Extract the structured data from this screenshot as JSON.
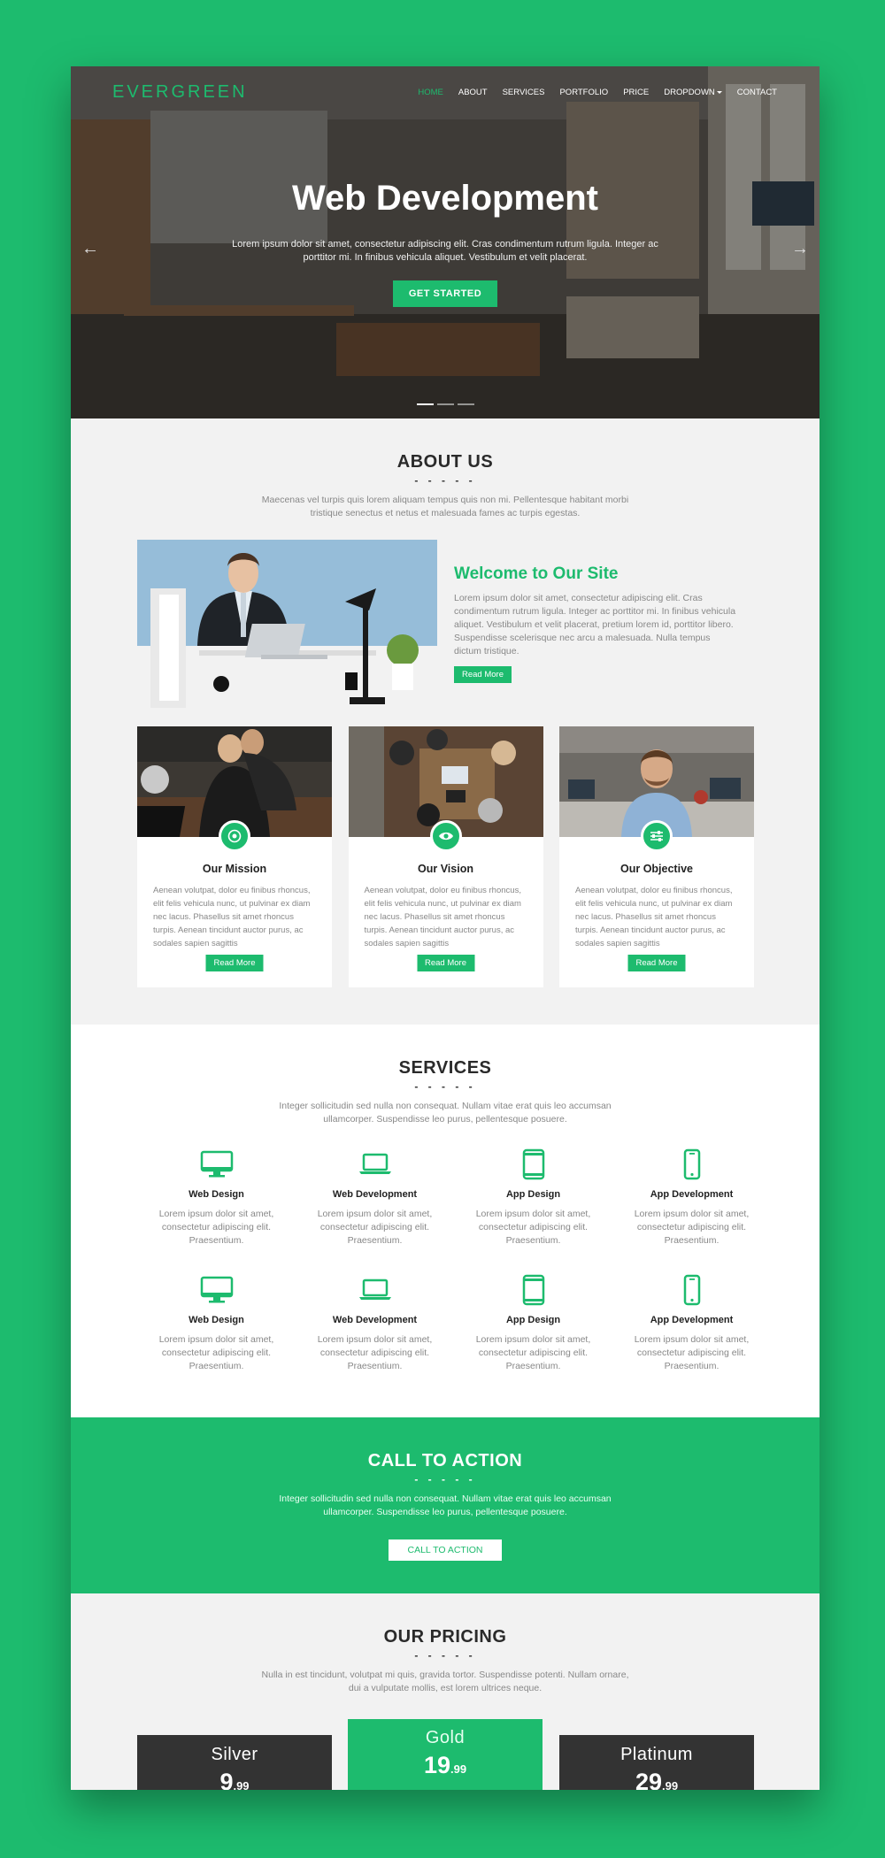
{
  "brand": {
    "logo": "EVERGREEN",
    "accent": "#1dbb6e"
  },
  "nav": {
    "items": [
      {
        "label": "HOME",
        "active": true
      },
      {
        "label": "ABOUT"
      },
      {
        "label": "SERVICES"
      },
      {
        "label": "PORTFOLIO"
      },
      {
        "label": "PRICE"
      },
      {
        "label": "DROPDOWN"
      },
      {
        "label": "CONTACT"
      }
    ]
  },
  "hero": {
    "title": "Web Development",
    "text": "Lorem ipsum dolor sit amet, consectetur adipiscing elit. Cras condimentum rutrum ligula. Integer ac porttitor mi. In finibus vehicula aliquet. Vestibulum et velit placerat.",
    "button": "GET STARTED"
  },
  "about": {
    "title": "ABOUT US",
    "dashes": "- - - - -",
    "subtitle": "Maecenas vel turpis quis lorem aliquam tempus quis non mi. Pellentesque habitant morbi tristique senectus et netus et malesuada fames ac turpis egestas.",
    "welcome": {
      "title": "Welcome to Our Site",
      "body": "Lorem ipsum dolor sit amet, consectetur adipiscing elit. Cras condimentum rutrum ligula. Integer ac porttitor mi. In finibus vehicula aliquet. Vestibulum et velit placerat, pretium lorem id, porttitor libero. Suspendisse scelerisque nec arcu a malesuada. Nulla tempus dictum tristique.",
      "button": "Read More"
    },
    "cards": [
      {
        "title": "Our Mission",
        "icon": "target-icon",
        "body": "Aenean volutpat, dolor eu finibus rhoncus, elit felis vehicula nunc, ut pulvinar ex diam nec lacus. Phasellus sit amet rhoncus turpis. Aenean tincidunt auctor purus, ac sodales sapien sagittis",
        "button": "Read More"
      },
      {
        "title": "Our Vision",
        "icon": "eye-icon",
        "body": "Aenean volutpat, dolor eu finibus rhoncus, elit felis vehicula nunc, ut pulvinar ex diam nec lacus. Phasellus sit amet rhoncus turpis. Aenean tincidunt auctor purus, ac sodales sapien sagittis",
        "button": "Read More"
      },
      {
        "title": "Our Objective",
        "icon": "sliders-icon",
        "body": "Aenean volutpat, dolor eu finibus rhoncus, elit felis vehicula nunc, ut pulvinar ex diam nec lacus. Phasellus sit amet rhoncus turpis. Aenean tincidunt auctor purus, ac sodales sapien sagittis",
        "button": "Read More"
      }
    ]
  },
  "services": {
    "title": "SERVICES",
    "dashes": "- - - - -",
    "subtitle": "Integer sollicitudin sed nulla non consequat. Nullam vitae erat quis leo accumsan ullamcorper. Suspendisse leo purus, pellentesque posuere.",
    "items": [
      {
        "title": "Web Design",
        "icon": "desktop-icon",
        "body": "Lorem ipsum dolor sit amet, consectetur adipiscing elit. Praesentium."
      },
      {
        "title": "Web Development",
        "icon": "laptop-icon",
        "body": "Lorem ipsum dolor sit amet, consectetur adipiscing elit. Praesentium."
      },
      {
        "title": "App Design",
        "icon": "tablet-icon",
        "body": "Lorem ipsum dolor sit amet, consectetur adipiscing elit. Praesentium."
      },
      {
        "title": "App Development",
        "icon": "phone-icon",
        "body": "Lorem ipsum dolor sit amet, consectetur adipiscing elit. Praesentium."
      },
      {
        "title": "Web Design",
        "icon": "desktop-icon",
        "body": "Lorem ipsum dolor sit amet, consectetur adipiscing elit. Praesentium."
      },
      {
        "title": "Web Development",
        "icon": "laptop-icon",
        "body": "Lorem ipsum dolor sit amet, consectetur adipiscing elit. Praesentium."
      },
      {
        "title": "App Design",
        "icon": "tablet-icon",
        "body": "Lorem ipsum dolor sit amet, consectetur adipiscing elit. Praesentium."
      },
      {
        "title": "App Development",
        "icon": "phone-icon",
        "body": "Lorem ipsum dolor sit amet, consectetur adipiscing elit. Praesentium."
      }
    ]
  },
  "cta": {
    "title": "CALL TO ACTION",
    "dashes": "- - - - -",
    "subtitle": "Integer sollicitudin sed nulla non consequat. Nullam vitae erat quis leo accumsan ullamcorper. Suspendisse leo purus, pellentesque posuere.",
    "button": "CALL TO ACTION"
  },
  "pricing": {
    "title": "OUR PRICING",
    "dashes": "- - - - -",
    "subtitle": "Nulla in est tincidunt, volutpat mi quis, gravida tortor. Suspendisse potenti. Nullam ornare, dui a vulputate mollis, est lorem ultrices neque.",
    "plans": [
      {
        "name": "Silver",
        "price": "9",
        "cents": ".99"
      },
      {
        "name": "Gold",
        "price": "19",
        "cents": ".99"
      },
      {
        "name": "Platinum",
        "price": "29",
        "cents": ".99"
      }
    ]
  }
}
